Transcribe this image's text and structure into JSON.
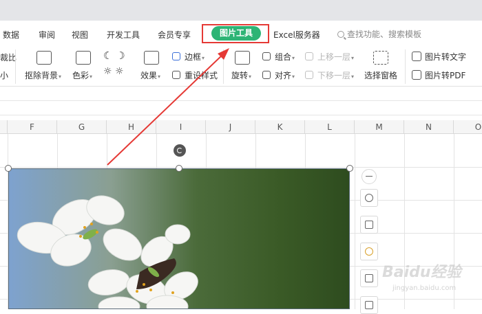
{
  "tabs": {
    "items": [
      "数据",
      "审阅",
      "视图",
      "开发工具",
      "会员专享",
      "图片工具",
      "Excel服务器"
    ],
    "active": "图片工具",
    "search_placeholder": "查找功能、搜索模板"
  },
  "toolbar": {
    "left_partial_1": "裁比",
    "left_partial_2": "小",
    "remove_bg": "抠除背景",
    "color": "色彩",
    "effects": "效果",
    "border": "边框",
    "reset_style": "重设样式",
    "rotate": "旋转",
    "group": "组合",
    "align": "对齐",
    "bring_forward": "上移一层",
    "send_backward": "下移一层",
    "selection_pane": "选择窗格",
    "pic_to_text": "图片转文字",
    "pic_to_pdf": "图片转PDF"
  },
  "columns": [
    "F",
    "G",
    "H",
    "I",
    "J",
    "K",
    "L",
    "M",
    "N",
    "O"
  ],
  "watermark": {
    "brand": "Baidu经验",
    "url": "jingyan.baidu.com"
  },
  "colors": {
    "accent": "#2db475",
    "annotation_red": "#e53935"
  }
}
